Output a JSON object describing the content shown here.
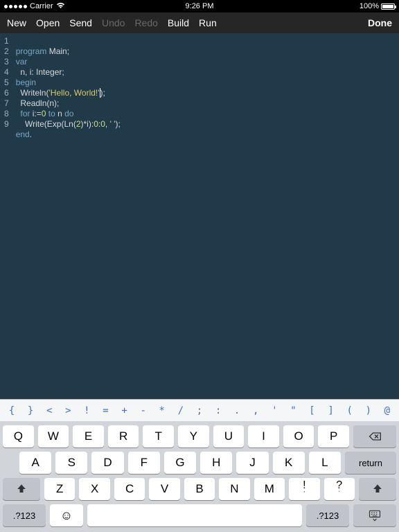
{
  "statusbar": {
    "carrier": "Carrier",
    "wifi": "wifi",
    "time": "9:26 PM",
    "battery": "100%"
  },
  "toolbar": {
    "new": "New",
    "open": "Open",
    "send": "Send",
    "undo": "Undo",
    "redo": "Redo",
    "build": "Build",
    "run": "Run",
    "done": "Done"
  },
  "code": {
    "lines": [
      "1",
      "2",
      "3",
      "4",
      "5",
      "6",
      "7",
      "8",
      "9"
    ],
    "l1_kw": "program",
    "l1_id": " Main;",
    "l2_kw": "var",
    "l3": "  n, i: Integer;",
    "l4_kw": "begin",
    "l5_a": "  Writeln(",
    "l5_str": "'Hello, World!'",
    "l5_b": ");",
    "l6": "  Readln(n);",
    "l7_a": "  ",
    "l7_for": "for",
    "l7_b": " i:=",
    "l7_n0": "0",
    "l7_c": " ",
    "l7_to": "to",
    "l7_d": " n ",
    "l7_do": "do",
    "l8_a": "    Write(Exp(Ln(",
    "l8_n2": "2",
    "l8_b": ")*i):",
    "l8_n0a": "0",
    "l8_c": ":",
    "l8_n0b": "0",
    "l8_d": ", ",
    "l8_s": "' '",
    "l8_e": ");",
    "l9_kw": "end",
    "l9_b": "."
  },
  "symbols": [
    "{",
    "}",
    "<",
    ">",
    "!",
    "=",
    "+",
    "-",
    "*",
    "/",
    ";",
    ":",
    ".",
    ",",
    "'",
    "\"",
    "[",
    "]",
    "(",
    ")",
    "@"
  ],
  "keys": {
    "row1": [
      "Q",
      "W",
      "E",
      "R",
      "T",
      "Y",
      "U",
      "I",
      "O",
      "P"
    ],
    "row2": [
      "A",
      "S",
      "D",
      "F",
      "G",
      "H",
      "J",
      "K",
      "L"
    ],
    "row3": [
      "Z",
      "X",
      "C",
      "V",
      "B",
      "N",
      "M"
    ],
    "punct1_main": "!",
    "punct1_sub": ",",
    "punct2_main": "?",
    "punct2_sub": ".",
    "return": "return",
    "numkey": ".?123"
  }
}
